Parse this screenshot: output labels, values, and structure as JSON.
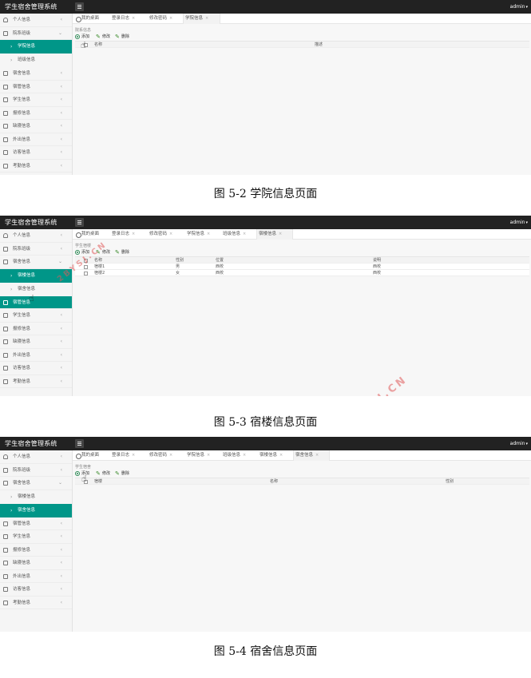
{
  "app": {
    "title": "学生宿舍管理系统",
    "user": "admin"
  },
  "screens": [
    {
      "sidebar": [
        {
          "label": "个人信息",
          "icon": "user-icon"
        },
        {
          "label": "院系班级",
          "icon": "file-icon"
        },
        {
          "label": "学院信息",
          "sub": true,
          "active": true
        },
        {
          "label": "班级信息",
          "sub": true
        },
        {
          "label": "宿舍信息",
          "icon": "file-icon"
        },
        {
          "label": "宿管信息",
          "icon": "file-icon"
        },
        {
          "label": "学生信息",
          "icon": "file-icon"
        },
        {
          "label": "报修信息",
          "icon": "file-icon"
        },
        {
          "label": "缺寝信息",
          "icon": "file-icon"
        },
        {
          "label": "外出信息",
          "icon": "file-icon"
        },
        {
          "label": "访客信息",
          "icon": "file-icon"
        },
        {
          "label": "考勤信息",
          "icon": "file-icon"
        }
      ],
      "tabs": [
        "我的桌面",
        "登录日志",
        "修改密码",
        "学院信息"
      ],
      "breadcrumb": "院系信息",
      "toolbar": {
        "add": "添加",
        "edit": "修改",
        "delete": "删除"
      },
      "columns": [
        "名称",
        "描述"
      ],
      "rows": [],
      "caption": "图 5-2 学院信息页面"
    },
    {
      "sidebar": [
        {
          "label": "个人信息",
          "icon": "user-icon"
        },
        {
          "label": "院系班级",
          "icon": "file-icon"
        },
        {
          "label": "宿舍信息",
          "icon": "file-icon"
        },
        {
          "label": "宿楼信息",
          "sub": true,
          "active": true
        },
        {
          "label": "宿舍信息",
          "sub": true
        },
        {
          "label": "宿管信息",
          "icon": "file-icon",
          "active": true
        },
        {
          "label": "学生信息",
          "icon": "file-icon"
        },
        {
          "label": "报修信息",
          "icon": "file-icon"
        },
        {
          "label": "缺寝信息",
          "icon": "file-icon"
        },
        {
          "label": "外出信息",
          "icon": "file-icon"
        },
        {
          "label": "访客信息",
          "icon": "file-icon"
        },
        {
          "label": "考勤信息",
          "icon": "file-icon"
        }
      ],
      "tabs": [
        "我的桌面",
        "登录日志",
        "修改密码",
        "学院信息",
        "班级信息",
        "宿楼信息"
      ],
      "breadcrumb": "学生宿楼",
      "toolbar": {
        "add": "添加",
        "edit": "修改",
        "delete": "删除"
      },
      "columns": [
        "名称",
        "性别",
        "位置",
        "说明"
      ],
      "rows": [
        [
          "宿楼1",
          "男",
          "西校",
          "西校"
        ],
        [
          "宿楼2",
          "女",
          "西校",
          "西校"
        ]
      ],
      "caption": "图 5-3 宿楼信息页面"
    },
    {
      "sidebar": [
        {
          "label": "个人信息",
          "icon": "user-icon"
        },
        {
          "label": "院系班级",
          "icon": "file-icon"
        },
        {
          "label": "宿舍信息",
          "icon": "file-icon"
        },
        {
          "label": "宿楼信息",
          "sub": true
        },
        {
          "label": "宿舍信息",
          "sub": true,
          "active": true
        },
        {
          "label": "宿管信息",
          "icon": "file-icon"
        },
        {
          "label": "学生信息",
          "icon": "file-icon"
        },
        {
          "label": "报修信息",
          "icon": "file-icon"
        },
        {
          "label": "缺寝信息",
          "icon": "file-icon"
        },
        {
          "label": "外出信息",
          "icon": "file-icon"
        },
        {
          "label": "访客信息",
          "icon": "file-icon"
        },
        {
          "label": "考勤信息",
          "icon": "file-icon"
        }
      ],
      "tabs": [
        "我的桌面",
        "登录日志",
        "修改密码",
        "学院信息",
        "班级信息",
        "宿楼信息",
        "宿舍信息"
      ],
      "breadcrumb": "学生宿舍",
      "toolbar": {
        "add": "添加",
        "edit": "修改",
        "delete": "删除"
      },
      "columns": [
        "宿楼",
        "名称",
        "性别"
      ],
      "rows": [],
      "caption": "图 5-4 宿舍信息页面"
    }
  ],
  "watermark": "2BYSJ.CN",
  "colors": {
    "topbar": "#222222",
    "accent": "#009688",
    "sidebar": "#f5f5f5",
    "watermark": "#e05a5a"
  }
}
